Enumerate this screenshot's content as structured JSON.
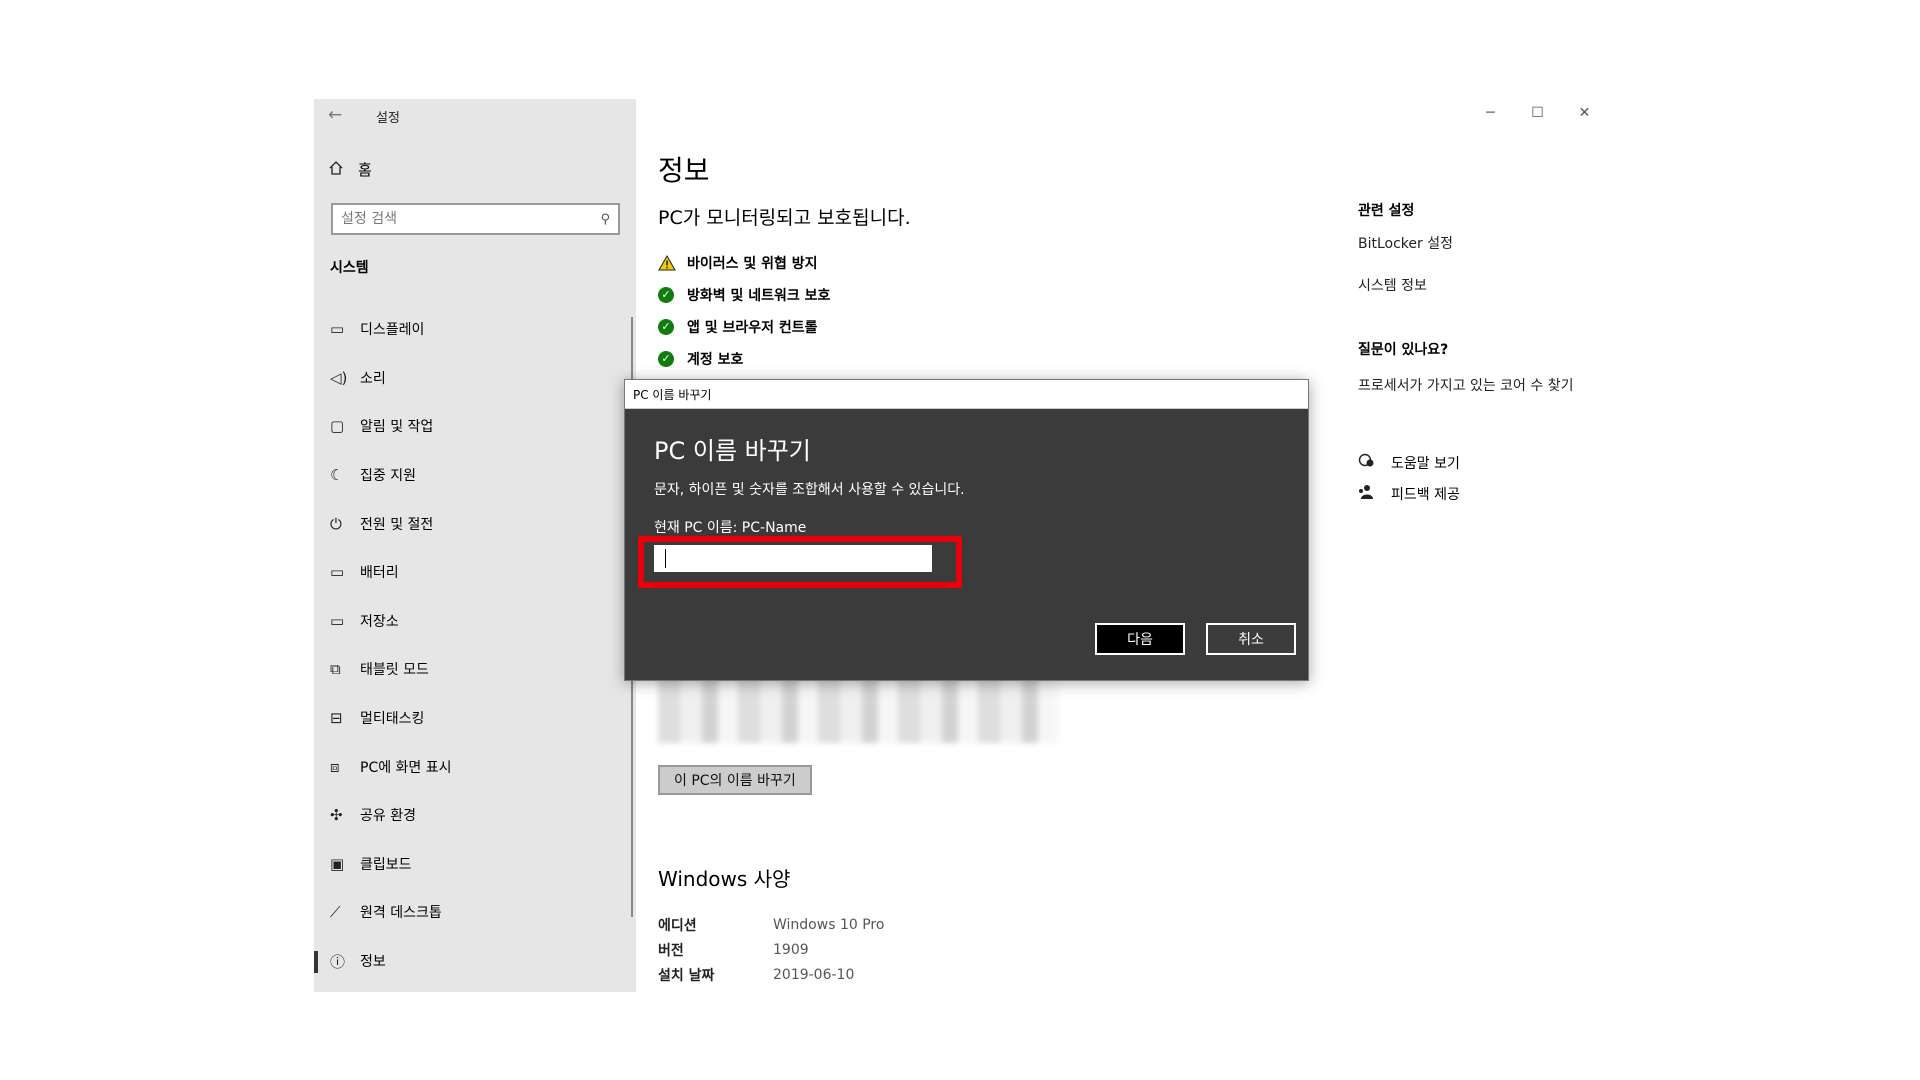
{
  "window": {
    "app_title": "설정",
    "controls": {
      "minimize": "─",
      "maximize": "☐",
      "close": "✕"
    }
  },
  "sidebar": {
    "back_icon": "back-arrow-icon",
    "home_label": "홈",
    "search_placeholder": "설정 검색",
    "section_title": "시스템",
    "items": [
      {
        "label": "디스플레이",
        "icon": "monitor-icon"
      },
      {
        "label": "소리",
        "icon": "speaker-icon"
      },
      {
        "label": "알림 및 작업",
        "icon": "notification-icon"
      },
      {
        "label": "집중 지원",
        "icon": "moon-icon"
      },
      {
        "label": "전원 및 절전",
        "icon": "power-icon"
      },
      {
        "label": "배터리",
        "icon": "battery-icon"
      },
      {
        "label": "저장소",
        "icon": "storage-icon"
      },
      {
        "label": "태블릿 모드",
        "icon": "tablet-icon"
      },
      {
        "label": "멀티태스킹",
        "icon": "multitask-icon"
      },
      {
        "label": "PC에 화면 표시",
        "icon": "project-icon"
      },
      {
        "label": "공유 환경",
        "icon": "share-icon"
      },
      {
        "label": "클립보드",
        "icon": "clipboard-icon"
      },
      {
        "label": "원격 데스크톱",
        "icon": "remote-desktop-icon"
      },
      {
        "label": "정보",
        "icon": "info-icon",
        "selected": true
      }
    ]
  },
  "main": {
    "title": "정보",
    "status_heading": "PC가 모니터링되고 보호됩니다.",
    "status_items": [
      {
        "label": "바이러스 및 위협 방지",
        "status": "warning"
      },
      {
        "label": "방화벽 및 네트워크 보호",
        "status": "ok"
      },
      {
        "label": "앱 및 브라우저 컨트롤",
        "status": "ok"
      },
      {
        "label": "계정 보호",
        "status": "ok"
      }
    ],
    "rename_button": "이 PC의 이름 바꾸기",
    "spec_heading": "Windows 사양",
    "specs": [
      {
        "label": "에디션",
        "value": "Windows 10 Pro"
      },
      {
        "label": "버전",
        "value": "1909"
      },
      {
        "label": "설치 날짜",
        "value": "2019-06-10"
      }
    ]
  },
  "related": {
    "heading": "관련 설정",
    "links": [
      "BitLocker 설정",
      "시스템 정보"
    ],
    "question_heading": "질문이 있나요?",
    "question_link": "프로세서가 가지고 있는 코어 수 찾기",
    "help_items": [
      {
        "label": "도움말 보기",
        "icon": "help-chat-icon"
      },
      {
        "label": "피드백 제공",
        "icon": "feedback-icon"
      }
    ]
  },
  "dialog": {
    "window_title": "PC 이름 바꾸기",
    "heading": "PC 이름 바꾸기",
    "description": "문자, 하이픈 및 숫자를 조합해서 사용할 수 있습니다.",
    "current_name": "현재 PC 이름: PC-Name",
    "input_value": "",
    "next_button": "다음",
    "cancel_button": "취소",
    "highlight_color": "#e8000b"
  }
}
